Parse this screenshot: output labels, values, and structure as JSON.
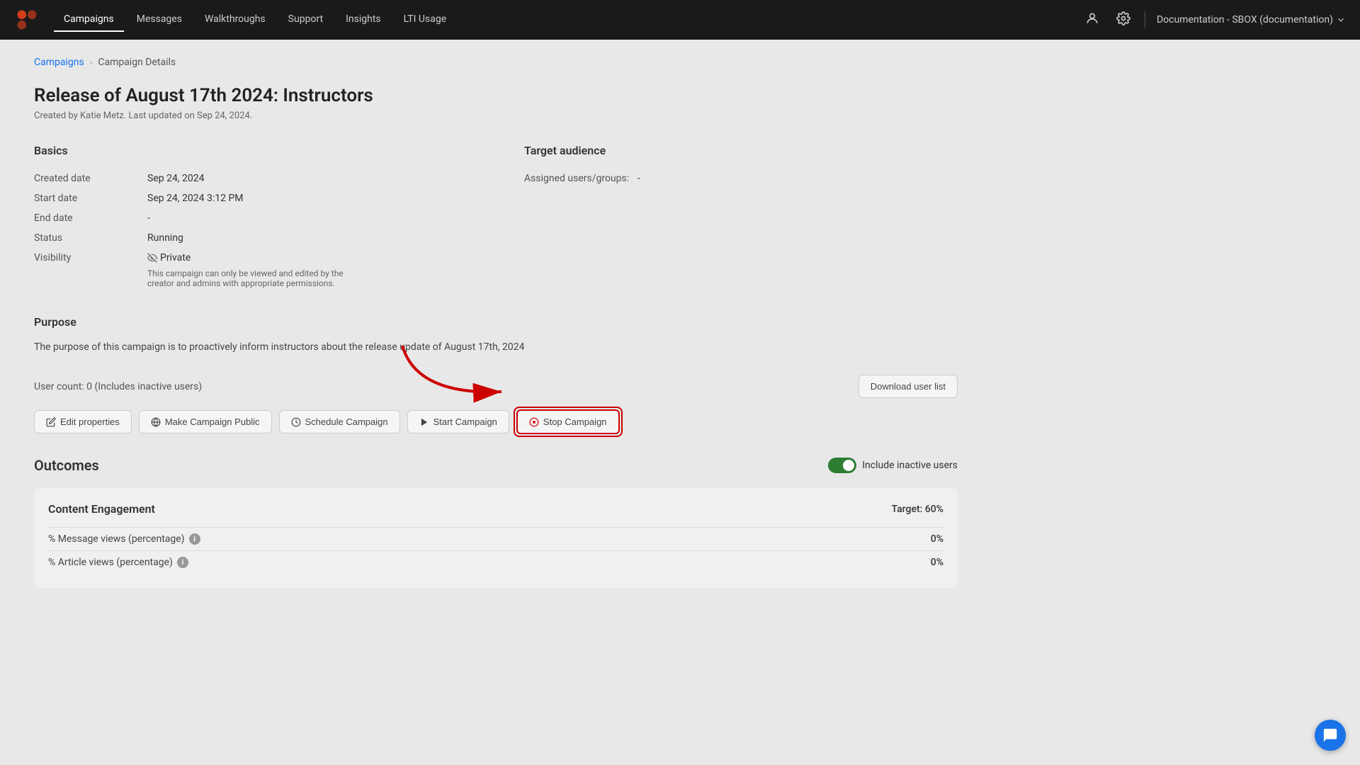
{
  "nav": {
    "items": [
      {
        "label": "Campaigns",
        "active": true
      },
      {
        "label": "Messages",
        "active": false
      },
      {
        "label": "Walkthroughs",
        "active": false
      },
      {
        "label": "Support",
        "active": false
      },
      {
        "label": "Insights",
        "active": false
      },
      {
        "label": "LTI Usage",
        "active": false
      }
    ],
    "workspace": "Documentation - SBOX (documentation)"
  },
  "breadcrumb": {
    "parent": "Campaigns",
    "current": "Campaign Details"
  },
  "campaign": {
    "title": "Release of August 17th 2024: Instructors",
    "subtitle": "Created by Katie Metz. Last updated on Sep 24, 2024.",
    "basics": {
      "label": "Basics",
      "fields": [
        {
          "label": "Created date",
          "value": "Sep 24, 2024"
        },
        {
          "label": "Start date",
          "value": "Sep 24, 2024 3:12 PM"
        },
        {
          "label": "End date",
          "value": "-"
        },
        {
          "label": "Status",
          "value": "Running"
        },
        {
          "label": "Visibility",
          "value": "Private"
        }
      ],
      "visibility_note": "This campaign can only be viewed and edited by the creator and admins with appropriate permissions."
    },
    "target_audience": {
      "label": "Target audience",
      "assigned_label": "Assigned users/groups:",
      "assigned_value": "-"
    },
    "purpose": {
      "label": "Purpose",
      "text": "The purpose of this campaign is to proactively inform instructors about the release update of August 17th, 2024"
    },
    "user_count": "User count: 0 (Includes inactive users)"
  },
  "buttons": {
    "edit": "Edit properties",
    "make_public": "Make Campaign Public",
    "schedule": "Schedule Campaign",
    "start": "Start Campaign",
    "stop": "Stop Campaign",
    "download": "Download user list"
  },
  "outcomes": {
    "title": "Outcomes",
    "include_inactive": "Include inactive users",
    "content_engagement": {
      "title": "Content Engagement",
      "target": "Target: 60%",
      "rows": [
        {
          "label": "% Message views (percentage)",
          "value": "0%"
        },
        {
          "label": "% Article views (percentage)",
          "value": "0%"
        }
      ]
    }
  }
}
